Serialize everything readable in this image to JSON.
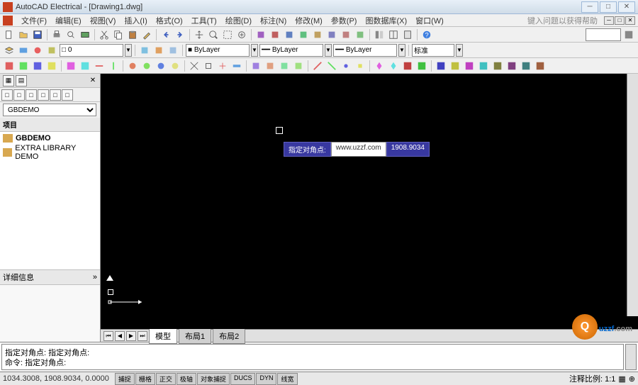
{
  "title": "AutoCAD Electrical - [Drawing1.dwg]",
  "menu": [
    "文件(F)",
    "编辑(E)",
    "视图(V)",
    "插入(I)",
    "格式(O)",
    "工具(T)",
    "绘图(D)",
    "标注(N)",
    "修改(M)",
    "参数(P)",
    "图数据库(X)",
    "窗口(W)"
  ],
  "helptext": "键入问题以获得帮助",
  "side": {
    "combo": "GBDEMO",
    "hdr": "项目",
    "items": [
      {
        "label": "GBDEMO",
        "bold": true
      },
      {
        "label": "EXTRA LIBRARY DEMO",
        "bold": false
      }
    ],
    "hdr2": "详细信息"
  },
  "tooltip": {
    "t1": "指定对角点:",
    "t2": "www.uzzf.com",
    "t3": "1908.9034"
  },
  "tabs": {
    "t1": "模型",
    "t2": "布局1",
    "t3": "布局2"
  },
  "cmd": {
    "line1": "指定对角点: 指定对角点:",
    "line2": "命令: 指定对角点:"
  },
  "status": {
    "coords": "1034.3008, 1908.9034, 0.0000",
    "btns": [
      "捕捉",
      "栅格",
      "正交",
      "极轴",
      "对象捕捉",
      "DUCS",
      "DYN",
      "线宽"
    ],
    "scale": "注释比例: 1:1"
  },
  "watermark": {
    "brand": "uzzf",
    "suffix": ".com"
  },
  "combos": {
    "layer1": "□ 0",
    "prop1": "■ ByLayer",
    "prop2": "━━ ByLayer",
    "prop3": "━━ ByLayer",
    "search": "标准"
  }
}
